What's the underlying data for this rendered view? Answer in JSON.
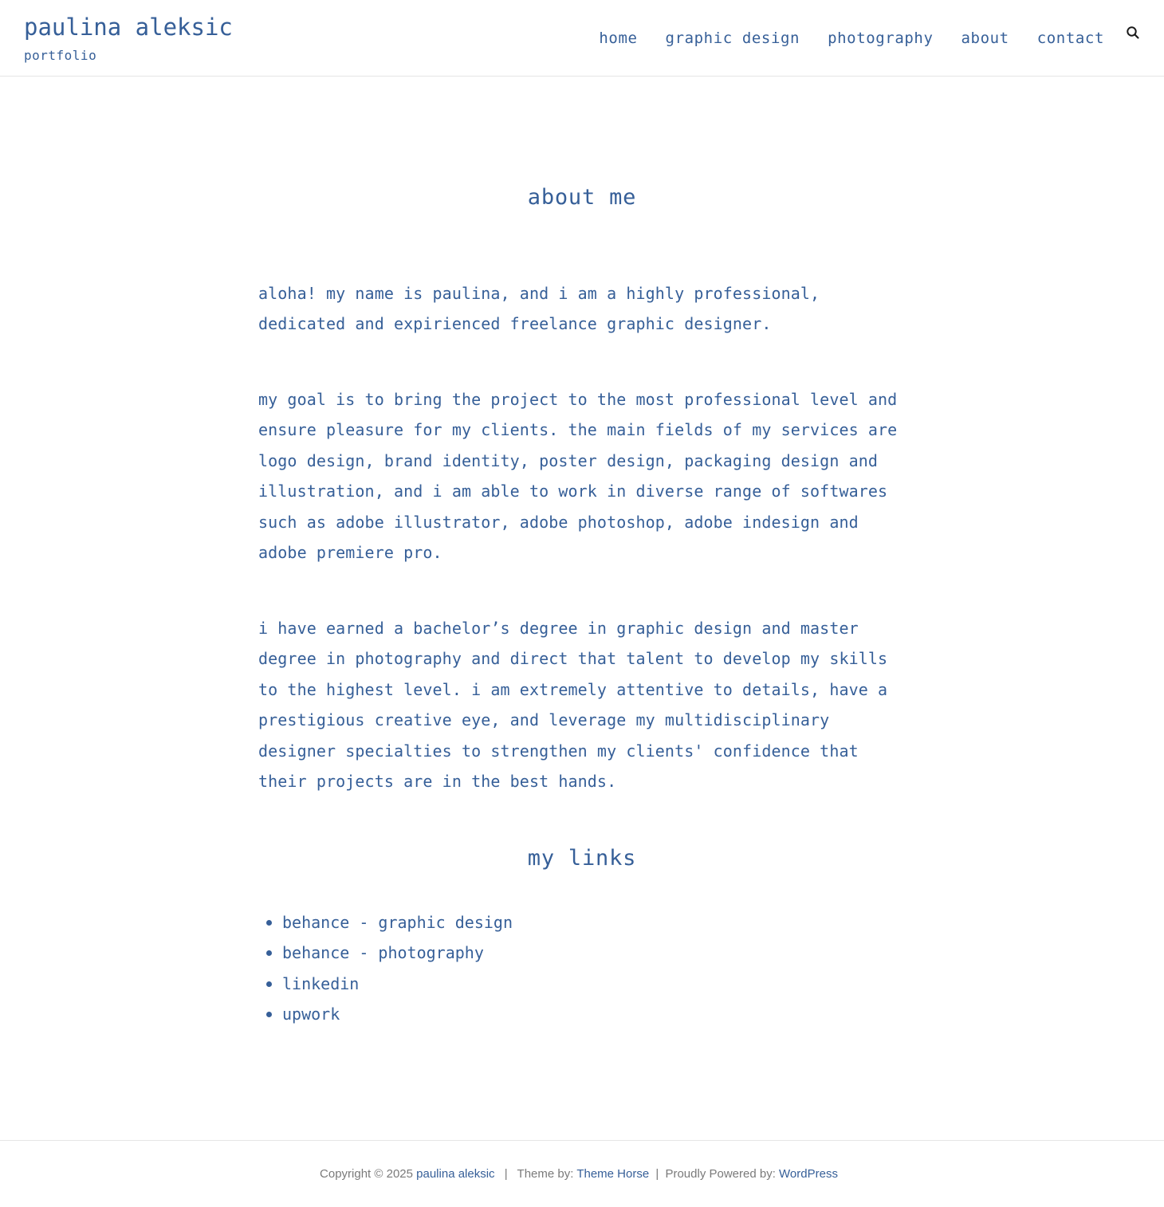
{
  "header": {
    "site_title": "paulina aleksic",
    "tagline": "portfolio",
    "nav": [
      {
        "label": "home"
      },
      {
        "label": "graphic design"
      },
      {
        "label": "photography"
      },
      {
        "label": "about"
      },
      {
        "label": "contact"
      }
    ],
    "search_icon": "search-icon"
  },
  "main": {
    "page_title": "about me",
    "paragraphs": [
      "aloha! my name is paulina, and i am a highly professional, dedicated and expirienced freelance graphic designer.",
      "my goal is to bring the project to the most professional level and ensure pleasure for my clients. the main fields of my services are logo design, brand identity, poster design, packaging design and illustration, and i am able to work in diverse range of softwares such as adobe illustrator, adobe photoshop, adobe indesign and adobe premiere pro.",
      "i have earned a bachelor’s degree in graphic design and master degree in photography and direct that talent to develop my skills to the highest level. i am extremely attentive to details, have a prestigious creative eye, and leverage my multidisciplinary designer specialties to strengthen my clients' confidence that their projects are in the best hands."
    ],
    "links_title": "my links",
    "links": [
      {
        "label": "behance - graphic design"
      },
      {
        "label": "behance - photography"
      },
      {
        "label": "linkedin"
      },
      {
        "label": "upwork"
      }
    ]
  },
  "footer": {
    "copyright_prefix": "Copyright © 2025",
    "copyright_link": "paulina aleksic",
    "separator": "|",
    "theme_prefix": "Theme by:",
    "theme_link": "Theme Horse",
    "powered_prefix": "Proudly Powered by:",
    "powered_link": "WordPress"
  },
  "colors": {
    "accent": "#365f98",
    "footer_text": "#7a7a7a",
    "background": "#ffffff",
    "divider": "#e6e6e6"
  }
}
